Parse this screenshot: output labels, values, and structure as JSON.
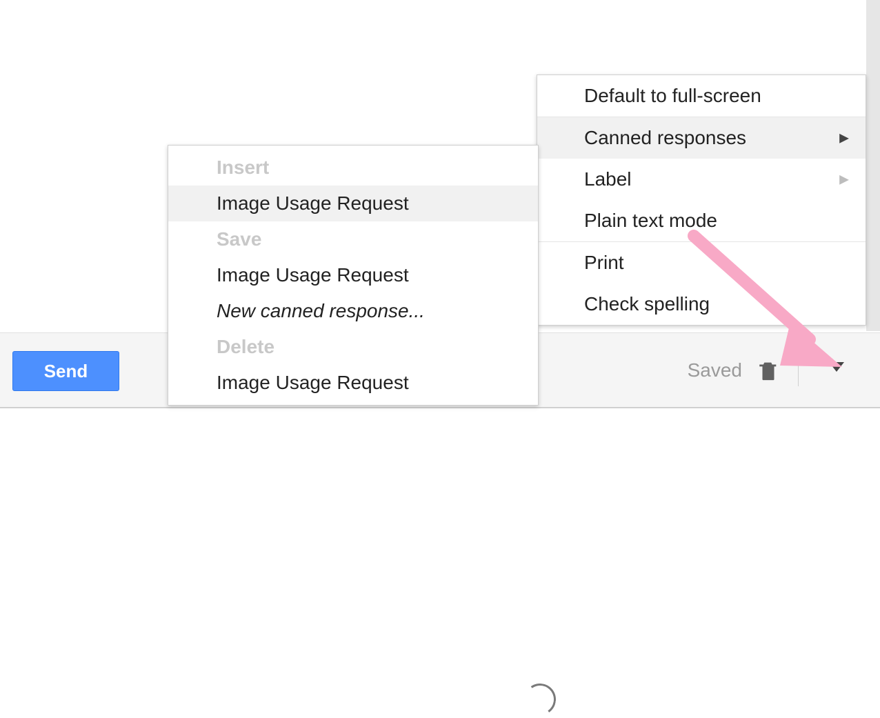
{
  "toolbar": {
    "send_label": "Send",
    "saved_label": "Saved"
  },
  "menu_primary": {
    "sections": [
      {
        "items": [
          {
            "label": "Default to full-screen"
          }
        ]
      },
      {
        "items": [
          {
            "label": "Canned responses",
            "submenu": true,
            "highlight": true
          },
          {
            "label": "Label",
            "submenu": true,
            "dim": true
          },
          {
            "label": "Plain text mode"
          }
        ]
      },
      {
        "items": [
          {
            "label": "Print"
          },
          {
            "label": "Check spelling"
          }
        ]
      }
    ]
  },
  "menu_sub": {
    "items": [
      {
        "label": "Insert",
        "type": "header"
      },
      {
        "label": "Image Usage Request",
        "highlight": true
      },
      {
        "label": "Save",
        "type": "header"
      },
      {
        "label": "Image Usage Request"
      },
      {
        "label": "New canned response...",
        "italic": true
      },
      {
        "label": "Delete",
        "type": "header"
      },
      {
        "label": "Image Usage Request"
      }
    ]
  }
}
